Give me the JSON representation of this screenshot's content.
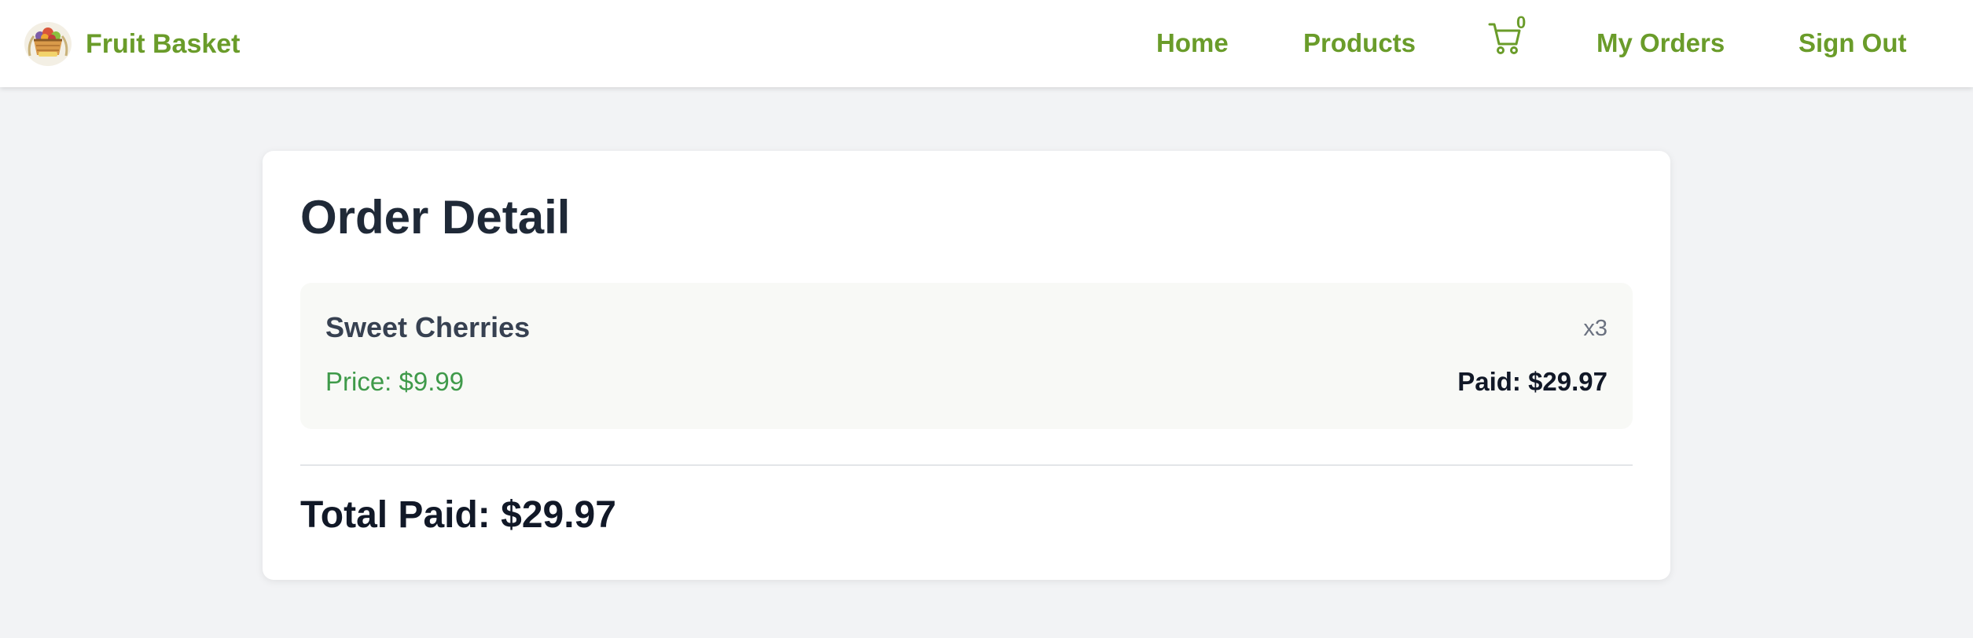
{
  "navbar": {
    "brand_name": "Fruit Basket",
    "logo_icon": "fruit-basket-logo-icon",
    "links": {
      "home": "Home",
      "products": "Products",
      "my_orders": "My Orders",
      "sign_out": "Sign Out"
    },
    "cart": {
      "icon": "cart-icon",
      "count": "0"
    }
  },
  "order": {
    "title": "Order Detail",
    "items": [
      {
        "name": "Sweet Cherries",
        "quantity": "x3",
        "price": "Price: $9.99",
        "paid": "Paid: $29.97"
      }
    ],
    "total_paid": "Total Paid: $29.97"
  },
  "colors": {
    "brand_green": "#6a9c2a",
    "price_green": "#3f9a4a",
    "page_background": "#f2f3f5",
    "card_background": "#ffffff",
    "item_background": "#f8f9f6",
    "heading_text": "#1f2937"
  }
}
